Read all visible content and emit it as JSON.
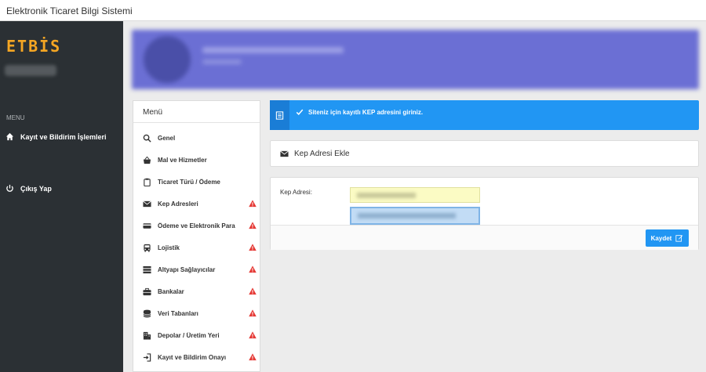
{
  "window": {
    "title": "Elektronik Ticaret Bilgi Sistemi"
  },
  "sidebar": {
    "logo": "ETBİS",
    "menu_heading": "MENU",
    "items": [
      {
        "label": "Kayıt ve Bildirim İşlemleri",
        "icon": "home-icon"
      },
      {
        "label": "Çıkış Yap",
        "icon": "power-icon"
      }
    ]
  },
  "menu_panel": {
    "title": "Menü",
    "items": [
      {
        "label": "Genel",
        "icon": "search-icon",
        "warning": false
      },
      {
        "label": "Mal ve Hizmetler",
        "icon": "basket-icon",
        "warning": false
      },
      {
        "label": "Ticaret Türü / Ödeme",
        "icon": "clipboard-icon",
        "warning": false
      },
      {
        "label": "Kep Adresleri",
        "icon": "envelope-icon",
        "warning": true
      },
      {
        "label": "Ödeme ve Elektronik Para",
        "icon": "credit-card-icon",
        "warning": true
      },
      {
        "label": "Lojistik",
        "icon": "bus-icon",
        "warning": true
      },
      {
        "label": "Altyapı Sağlayıcılar",
        "icon": "server-icon",
        "warning": true
      },
      {
        "label": "Bankalar",
        "icon": "briefcase-icon",
        "warning": true
      },
      {
        "label": "Veri Tabanları",
        "icon": "database-icon",
        "warning": true
      },
      {
        "label": "Depolar / Üretim Yeri",
        "icon": "building-icon",
        "warning": true
      },
      {
        "label": "Kayıt ve Bildirim Onayı",
        "icon": "sign-in-icon",
        "warning": true
      }
    ]
  },
  "info": {
    "message": "Siteniz için kayıtlı KEP adresini giriniz."
  },
  "kep_card": {
    "title": "Kep Adresi Ekle"
  },
  "form": {
    "label": "Kep Adresi:",
    "save_label": "Kaydet"
  },
  "colors": {
    "accent": "#2196f3",
    "sidebar": "#2b3034",
    "logo": "#f5a623",
    "warning": "#e53935"
  }
}
